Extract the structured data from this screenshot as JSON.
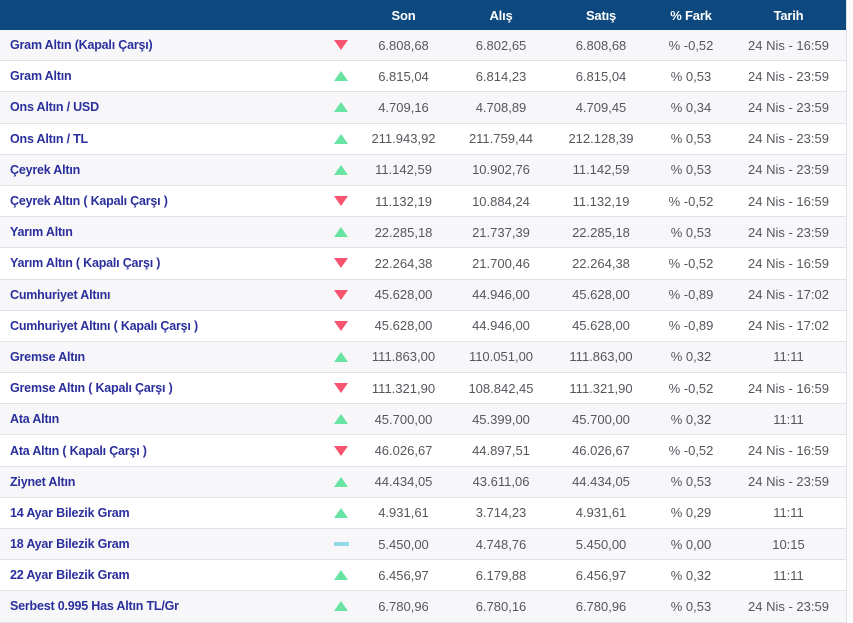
{
  "table": {
    "columns": [
      "Son",
      "Alış",
      "Satış",
      "% Fark",
      "Tarih"
    ],
    "rows": [
      {
        "name": "Gram Altın (Kapalı Çarşı)",
        "direction": "down",
        "son": "6.808,68",
        "alis": "6.802,65",
        "satis": "6.808,68",
        "fark": "% -0,52",
        "tarih": "24 Nis - 16:59"
      },
      {
        "name": "Gram Altın",
        "direction": "up",
        "son": "6.815,04",
        "alis": "6.814,23",
        "satis": "6.815,04",
        "fark": "% 0,53",
        "tarih": "24 Nis - 23:59"
      },
      {
        "name": "Ons Altın / USD",
        "direction": "up",
        "son": "4.709,16",
        "alis": "4.708,89",
        "satis": "4.709,45",
        "fark": "% 0,34",
        "tarih": "24 Nis - 23:59"
      },
      {
        "name": "Ons Altın / TL",
        "direction": "up",
        "son": "211.943,92",
        "alis": "211.759,44",
        "satis": "212.128,39",
        "fark": "% 0,53",
        "tarih": "24 Nis - 23:59"
      },
      {
        "name": "Çeyrek Altın",
        "direction": "up",
        "son": "11.142,59",
        "alis": "10.902,76",
        "satis": "11.142,59",
        "fark": "% 0,53",
        "tarih": "24 Nis - 23:59"
      },
      {
        "name": "Çeyrek Altın ( Kapalı Çarşı )",
        "direction": "down",
        "son": "11.132,19",
        "alis": "10.884,24",
        "satis": "11.132,19",
        "fark": "% -0,52",
        "tarih": "24 Nis - 16:59"
      },
      {
        "name": "Yarım Altın",
        "direction": "up",
        "son": "22.285,18",
        "alis": "21.737,39",
        "satis": "22.285,18",
        "fark": "% 0,53",
        "tarih": "24 Nis - 23:59"
      },
      {
        "name": "Yarım Altın ( Kapalı Çarşı )",
        "direction": "down",
        "son": "22.264,38",
        "alis": "21.700,46",
        "satis": "22.264,38",
        "fark": "% -0,52",
        "tarih": "24 Nis - 16:59"
      },
      {
        "name": "Cumhuriyet Altını",
        "direction": "down",
        "son": "45.628,00",
        "alis": "44.946,00",
        "satis": "45.628,00",
        "fark": "% -0,89",
        "tarih": "24 Nis - 17:02"
      },
      {
        "name": "Cumhuriyet Altını ( Kapalı Çarşı )",
        "direction": "down",
        "son": "45.628,00",
        "alis": "44.946,00",
        "satis": "45.628,00",
        "fark": "% -0,89",
        "tarih": "24 Nis - 17:02"
      },
      {
        "name": "Gremse Altın",
        "direction": "up",
        "son": "111.863,00",
        "alis": "110.051,00",
        "satis": "111.863,00",
        "fark": "% 0,32",
        "tarih": "11:11"
      },
      {
        "name": "Gremse Altın ( Kapalı Çarşı )",
        "direction": "down",
        "son": "111.321,90",
        "alis": "108.842,45",
        "satis": "111.321,90",
        "fark": "% -0,52",
        "tarih": "24 Nis - 16:59"
      },
      {
        "name": "Ata Altın",
        "direction": "up",
        "son": "45.700,00",
        "alis": "45.399,00",
        "satis": "45.700,00",
        "fark": "% 0,32",
        "tarih": "11:11"
      },
      {
        "name": "Ata Altın ( Kapalı Çarşı )",
        "direction": "down",
        "son": "46.026,67",
        "alis": "44.897,51",
        "satis": "46.026,67",
        "fark": "% -0,52",
        "tarih": "24 Nis - 16:59"
      },
      {
        "name": "Ziynet Altın",
        "direction": "up",
        "son": "44.434,05",
        "alis": "43.611,06",
        "satis": "44.434,05",
        "fark": "% 0,53",
        "tarih": "24 Nis - 23:59"
      },
      {
        "name": "14 Ayar Bilezik Gram",
        "direction": "up",
        "son": "4.931,61",
        "alis": "3.714,23",
        "satis": "4.931,61",
        "fark": "% 0,29",
        "tarih": "11:11"
      },
      {
        "name": "18 Ayar Bilezik Gram",
        "direction": "flat",
        "son": "5.450,00",
        "alis": "4.748,76",
        "satis": "5.450,00",
        "fark": "% 0,00",
        "tarih": "10:15"
      },
      {
        "name": "22 Ayar Bilezik Gram",
        "direction": "up",
        "son": "6.456,97",
        "alis": "6.179,88",
        "satis": "6.456,97",
        "fark": "% 0,32",
        "tarih": "11:11"
      },
      {
        "name": "Serbest 0.995 Has Altın TL/Gr",
        "direction": "up",
        "son": "6.780,96",
        "alis": "6.780,16",
        "satis": "6.780,96",
        "fark": "% 0,53",
        "tarih": "24 Nis - 23:59"
      }
    ]
  },
  "colors": {
    "header_bg": "#0d487e",
    "header_text": "#ffffff",
    "row_name": "#2a2f9c",
    "value_text": "#56575d",
    "row_bg": "#ffffff",
    "row_alt_bg": "#f7f7f9",
    "border": "#e2e3e9",
    "up": "#68e3a2",
    "down": "#f8536f",
    "flat": "#8ed9e2"
  }
}
